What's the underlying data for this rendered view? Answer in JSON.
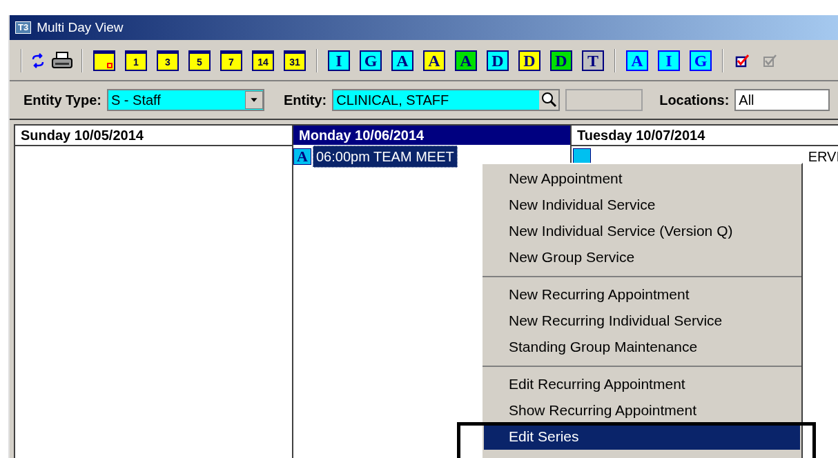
{
  "window": {
    "title": "Multi Day View",
    "app_icon_text": "T3"
  },
  "toolbar": {
    "groups": [
      [
        {
          "kind": "refresh"
        },
        {
          "kind": "print"
        }
      ],
      [
        {
          "kind": "calendar_marked"
        },
        {
          "kind": "calendar",
          "label": "1"
        },
        {
          "kind": "calendar",
          "label": "3"
        },
        {
          "kind": "calendar",
          "label": "5"
        },
        {
          "kind": "calendar",
          "label": "7"
        },
        {
          "kind": "calendar",
          "label": "14"
        },
        {
          "kind": "calendar",
          "label": "31"
        }
      ],
      [
        {
          "kind": "letter",
          "label": "I",
          "color": "#00ffff"
        },
        {
          "kind": "letter",
          "label": "G",
          "color": "#00ffff"
        },
        {
          "kind": "letter",
          "label": "A",
          "color": "#00ffff"
        },
        {
          "kind": "letter",
          "label": "A",
          "color": "#ffff00"
        },
        {
          "kind": "letter",
          "label": "A",
          "color": "#00e000"
        },
        {
          "kind": "letter",
          "label": "D",
          "color": "#00ffff"
        },
        {
          "kind": "letter",
          "label": "D",
          "color": "#ffff00"
        },
        {
          "kind": "letter",
          "label": "D",
          "color": "#00e000"
        },
        {
          "kind": "letter",
          "label": "T",
          "color": "#c0c0c0"
        }
      ],
      [
        {
          "kind": "bright",
          "label": "A",
          "color": "#00ffff"
        },
        {
          "kind": "bright",
          "label": "I",
          "color": "#00ffff"
        },
        {
          "kind": "bright",
          "label": "G",
          "color": "#00ffff"
        }
      ],
      [
        {
          "kind": "check"
        },
        {
          "kind": "check_gray"
        }
      ]
    ]
  },
  "filters": {
    "entity_type": {
      "label": "Entity Type:",
      "value": "S - Staff"
    },
    "entity": {
      "label": "Entity:",
      "value": "CLINICAL, STAFF"
    },
    "locations": {
      "label": "Locations:",
      "value": "All"
    }
  },
  "days": [
    {
      "header": "Sunday 10/05/2014",
      "selected": false
    },
    {
      "header": "Monday 10/06/2014",
      "selected": true,
      "appointments": [
        {
          "icon": "A",
          "text": "06:00pm TEAM MEET",
          "selected": true
        }
      ]
    },
    {
      "header": "Tuesday 10/07/2014",
      "selected": false,
      "appointments": [
        {
          "text": "ERVI",
          "selected": false
        }
      ]
    }
  ],
  "context_menu": {
    "groups": [
      [
        {
          "label": "New Appointment",
          "selected": false
        },
        {
          "label": "New Individual Service",
          "selected": false
        },
        {
          "label": "New Individual Service (Version Q)",
          "selected": false
        },
        {
          "label": "New Group Service",
          "selected": false
        }
      ],
      [
        {
          "label": "New Recurring Appointment",
          "selected": false
        },
        {
          "label": "New Recurring Individual Service",
          "selected": false
        },
        {
          "label": "Standing Group Maintenance",
          "selected": false
        }
      ],
      [
        {
          "label": "Edit Recurring Appointment",
          "selected": false
        },
        {
          "label": "Show Recurring Appointment",
          "selected": false
        },
        {
          "label": "Edit Series",
          "selected": true
        }
      ]
    ]
  }
}
